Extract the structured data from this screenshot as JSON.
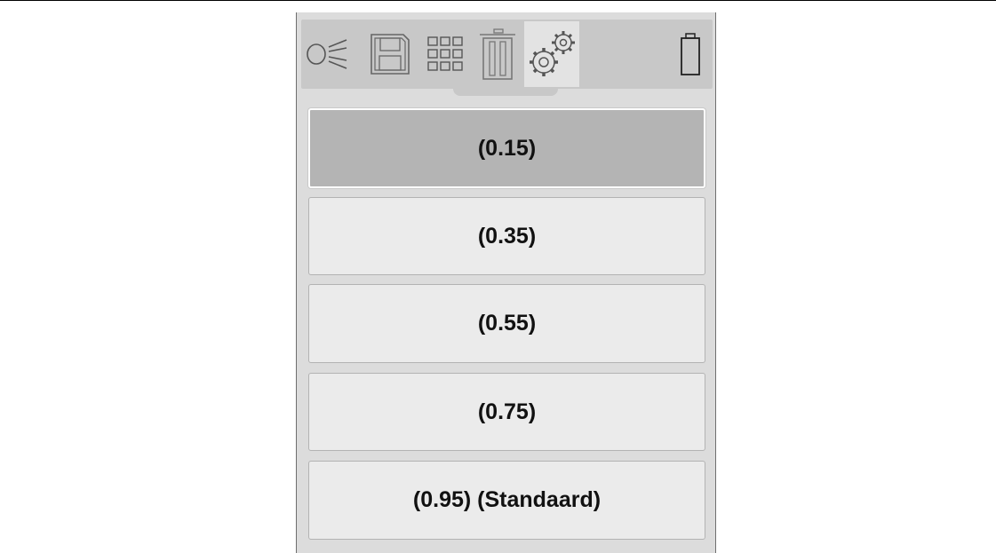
{
  "toolbar": {
    "tabs": [
      {
        "icon": "headlight-icon",
        "active": false
      },
      {
        "icon": "floppy-disk-icon",
        "active": false
      },
      {
        "icon": "grid-icon",
        "active": false
      },
      {
        "icon": "trash-icon",
        "active": false
      },
      {
        "icon": "gears-icon",
        "active": true
      }
    ],
    "status_icon": "battery-icon"
  },
  "options": [
    {
      "label": "(0.15)",
      "selected": true
    },
    {
      "label": "(0.35)",
      "selected": false
    },
    {
      "label": "(0.55)",
      "selected": false
    },
    {
      "label": "(0.75)",
      "selected": false
    },
    {
      "label": "(0.95) (Standaard)",
      "selected": false
    }
  ],
  "colors": {
    "panel": "#dcdcdc",
    "toolbar": "#c8c8c8",
    "option_bg": "#ebebeb",
    "option_selected_bg": "#b4b4b4",
    "icon_stroke": "#555555"
  }
}
